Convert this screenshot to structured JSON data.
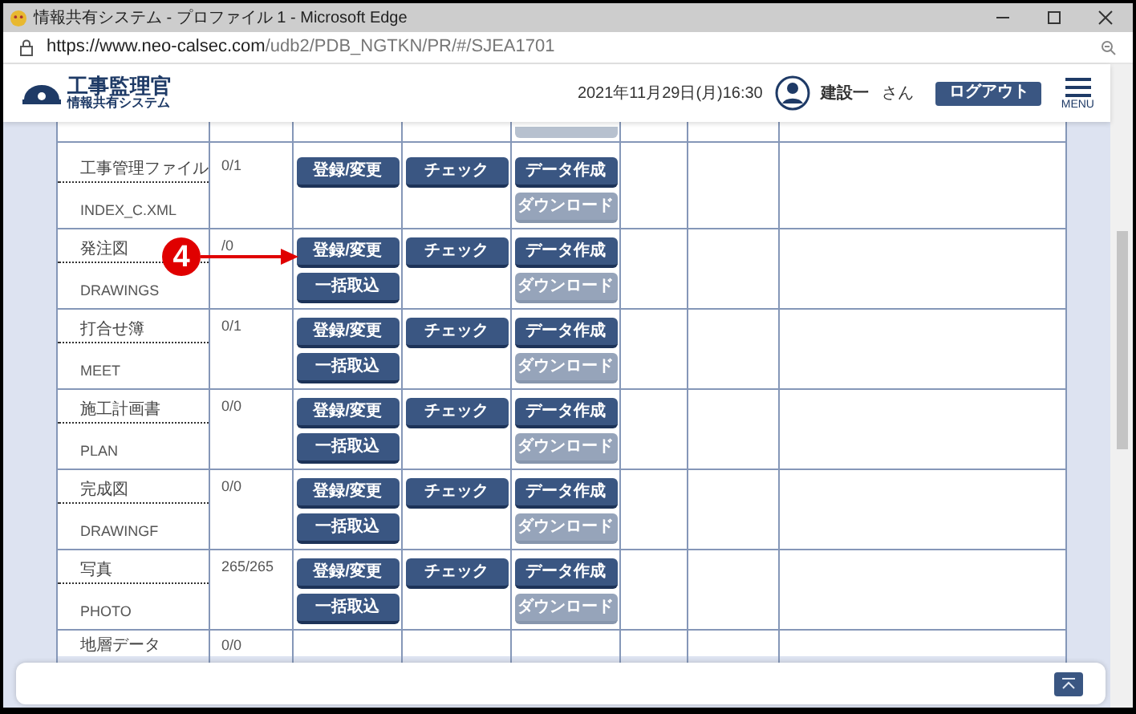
{
  "window": {
    "title": "情報共有システム - プロファイル 1 - Microsoft Edge"
  },
  "address_bar": {
    "url_host": "https://www.neo-calsec.com",
    "url_path": "/udb2/PDB_NGTKN/PR/#/SJEA1701"
  },
  "header": {
    "logo_title": "工事監理官",
    "logo_subtitle": "情報共有システム",
    "datetime": "2021年11月29日(月)16:30",
    "user_name": "建設一",
    "user_suffix": "さん",
    "logout": "ログアウト",
    "menu_label": "MENU"
  },
  "annotation": {
    "number": "4"
  },
  "rows": [
    {
      "name": "工事管理ファイル",
      "code": "INDEX_C.XML",
      "count": "0/1",
      "register": "登録/変更",
      "check": "チェック",
      "create": "データ作成",
      "download": {
        "label": "ダウンロード",
        "disabled": true
      }
    },
    {
      "name": "発注図",
      "code": "DRAWINGS",
      "count": "/0",
      "register": "登録/変更",
      "bulk_import": "一括取込",
      "check": "チェック",
      "create": "データ作成",
      "download": {
        "label": "ダウンロード",
        "disabled": true
      }
    },
    {
      "name": "打合せ簿",
      "code": "MEET",
      "count": "0/1",
      "register": "登録/変更",
      "bulk_import": "一括取込",
      "check": "チェック",
      "create": "データ作成",
      "download": {
        "label": "ダウンロード",
        "disabled": true
      }
    },
    {
      "name": "施工計画書",
      "code": "PLAN",
      "count": "0/0",
      "register": "登録/変更",
      "bulk_import": "一括取込",
      "check": "チェック",
      "create": "データ作成",
      "download": {
        "label": "ダウンロード",
        "disabled": true
      }
    },
    {
      "name": "完成図",
      "code": "DRAWINGF",
      "count": "0/0",
      "register": "登録/変更",
      "bulk_import": "一括取込",
      "check": "チェック",
      "create": "データ作成",
      "download": {
        "label": "ダウンロード",
        "disabled": true
      }
    },
    {
      "name": "写真",
      "code": "PHOTO",
      "count": "265/265",
      "register": "登録/変更",
      "bulk_import": "一括取込",
      "check": "チェック",
      "create": "データ作成",
      "download": {
        "label": "ダウンロード",
        "disabled": true
      }
    }
  ],
  "partial_row": {
    "name": "地層データ",
    "count": "0/0"
  }
}
